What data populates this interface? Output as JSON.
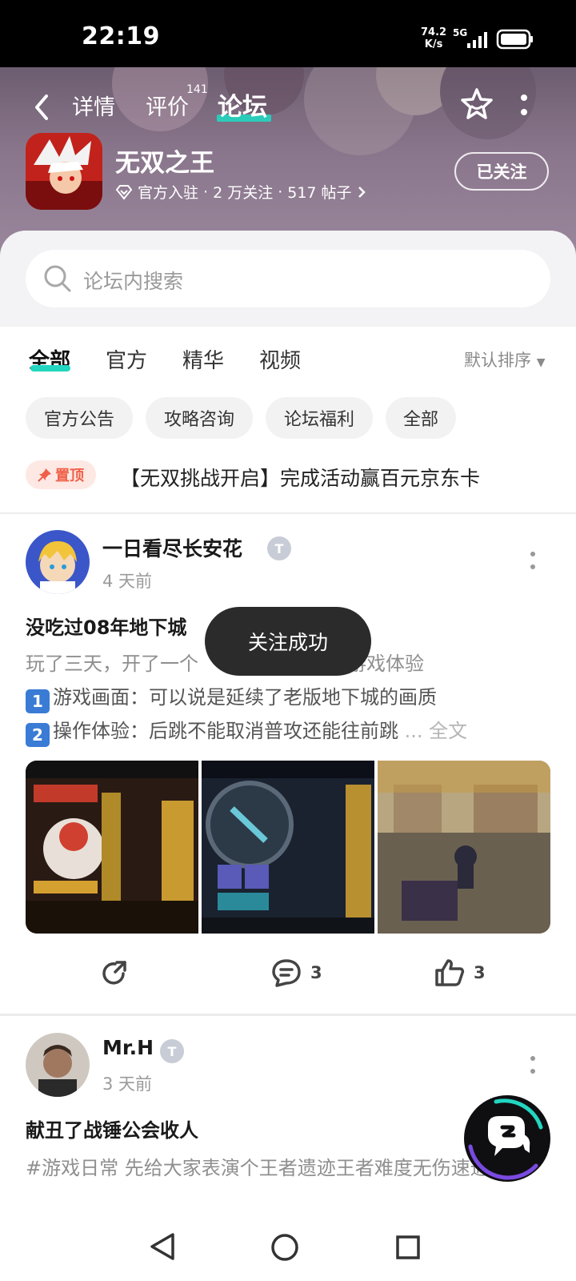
{
  "status_bar": {
    "time": "22:19",
    "net_speed_top": "74.2",
    "net_speed_bottom": "K/s",
    "network": "5G"
  },
  "nav": {
    "tab_detail": "详情",
    "tab_review": "评价",
    "review_count": "141",
    "tab_forum": "论坛"
  },
  "game": {
    "name": "无双之王",
    "verified": "官方入驻",
    "followers": "2 万关注",
    "posts": "517 帖子",
    "follow_label": "已关注"
  },
  "search": {
    "placeholder": "论坛内搜索"
  },
  "filter_tabs": [
    "全部",
    "官方",
    "精华",
    "视频"
  ],
  "sort_label": "默认排序",
  "chips": [
    "官方公告",
    "攻略咨询",
    "论坛福利",
    "全部"
  ],
  "pinned": {
    "badge": "置顶",
    "title": "【无双挑战开启】完成活动赢百元京东卡"
  },
  "posts": [
    {
      "author": "一日看尽长安花",
      "level": "T",
      "time": "4 天前",
      "title": "没吃过08年地下城",
      "intro": "玩了三天，开了一个",
      "intro_end": "游戏体验",
      "line1_num": "1",
      "line1": "游戏画面：可以说是延续了老版地下城的画质",
      "line2_num": "2",
      "line2": "操作体验：后跳不能取消普攻还能往前跳",
      "fulltext": "... 全文",
      "comments": "3",
      "likes": "3"
    },
    {
      "author": "Mr.H",
      "level": "T",
      "time": "3 天前",
      "title": "献丑了战锤公会收人",
      "body": "#游戏日常 先给大家表演个王者遗迹王者难度无伤速通吧"
    }
  ],
  "toast": "关注成功",
  "colors": {
    "accent": "#22d6c0",
    "pin": "#f06048",
    "toast_bg": "#2b2b2b"
  }
}
